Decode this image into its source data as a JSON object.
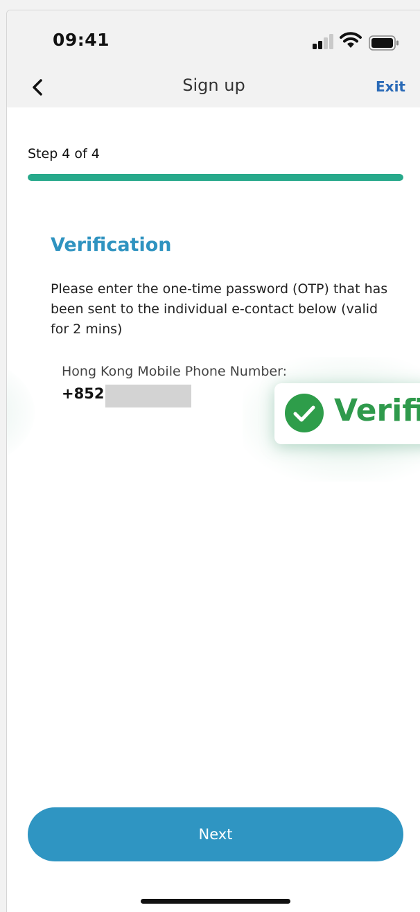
{
  "status_bar": {
    "time": "09:41"
  },
  "nav": {
    "title": "Sign up",
    "exit_label": "Exit"
  },
  "progress": {
    "step_label": "Step 4 of 4",
    "fraction": 1.0
  },
  "verification": {
    "heading": "Verification",
    "instructions": "Please enter the one-time password (OTP) that has been sent to the individual e-contact below (valid for 2 mins)",
    "phone_label": "Hong Kong Mobile Phone Number:",
    "country_code": "+852"
  },
  "toast": {
    "text": "Verifie"
  },
  "actions": {
    "next_label": "Next"
  },
  "colors": {
    "accent": "#2f95c2",
    "progress": "#27a98b",
    "success": "#2f9a4c",
    "link": "#2a6ab7"
  },
  "icons": [
    "back-chevron-icon",
    "signal-icon",
    "wifi-icon",
    "battery-icon",
    "check-circle-icon"
  ]
}
